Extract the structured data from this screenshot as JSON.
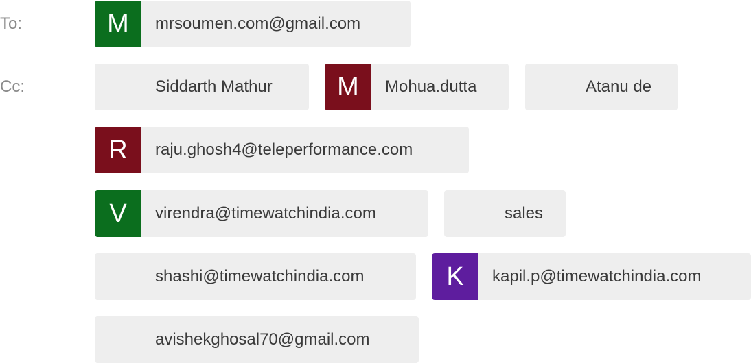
{
  "to": {
    "label": "To:",
    "recipients": [
      {
        "initial": "M",
        "avatar_color": "#0b6e1e",
        "text": "mrsoumen.com@gmail.com"
      }
    ]
  },
  "cc": {
    "label": "Cc:",
    "recipients": [
      {
        "initial": "",
        "avatar_color": "",
        "text": "Siddarth Mathur"
      },
      {
        "initial": "M",
        "avatar_color": "#7a0f1c",
        "text": "Mohua.dutta"
      },
      {
        "initial": "",
        "avatar_color": "",
        "text": "Atanu de"
      },
      {
        "initial": "R",
        "avatar_color": "#7a0f1c",
        "text": "raju.ghosh4@teleperformance.com"
      },
      {
        "initial": "V",
        "avatar_color": "#0b6e1e",
        "text": "virendra@timewatchindia.com"
      },
      {
        "initial": "",
        "avatar_color": "",
        "text": "sales"
      },
      {
        "initial": "",
        "avatar_color": "",
        "text": "shashi@timewatchindia.com"
      },
      {
        "initial": "K",
        "avatar_color": "#5e1d9e",
        "text": "kapil.p@timewatchindia.com"
      },
      {
        "initial": "",
        "avatar_color": "",
        "text": "avishekghosal70@gmail.com"
      }
    ]
  }
}
